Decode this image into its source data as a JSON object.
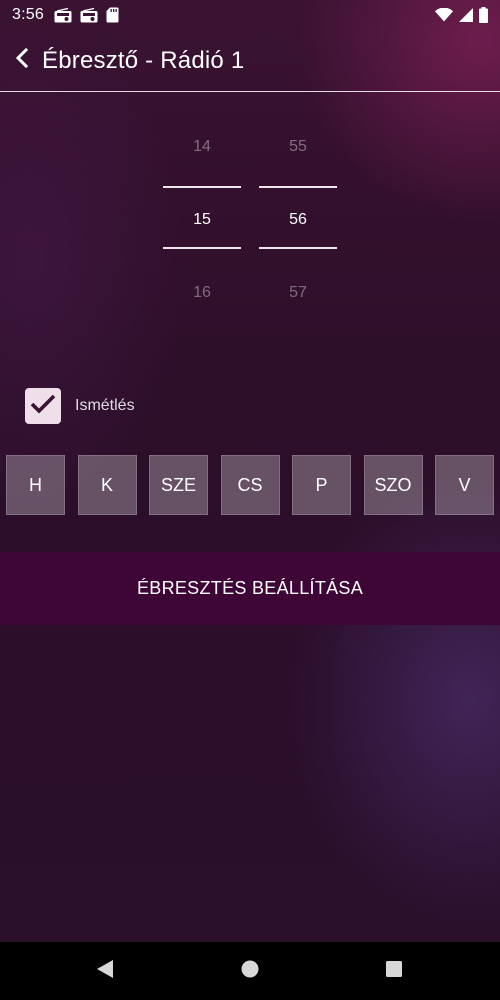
{
  "status_bar": {
    "time": "3:56",
    "left_icons": [
      "radio-icon",
      "radio-icon",
      "sd-card-icon"
    ],
    "right_icons": [
      "wifi-icon",
      "signal-icon",
      "battery-icon"
    ]
  },
  "app_bar": {
    "title": "Ébresztő - Rádió 1",
    "back_icon": "back-arrow-icon"
  },
  "time_picker": {
    "hours": {
      "prev": "14",
      "current": "15",
      "next": "16"
    },
    "minutes": {
      "prev": "55",
      "current": "56",
      "next": "57"
    }
  },
  "repeat": {
    "label": "Ismétlés",
    "checked": true
  },
  "days": [
    "H",
    "K",
    "SZE",
    "CS",
    "P",
    "SZO",
    "V"
  ],
  "set_button": {
    "label": "ÉBRESZTÉS BEÁLLÍTÁSA"
  },
  "nav_bar": {
    "icons": [
      "nav-back-icon",
      "nav-home-icon",
      "nav-recents-icon"
    ]
  },
  "colors": {
    "accent": "#3d0636",
    "checkbox": "#eedfe9",
    "background": "#2e0f2a"
  }
}
